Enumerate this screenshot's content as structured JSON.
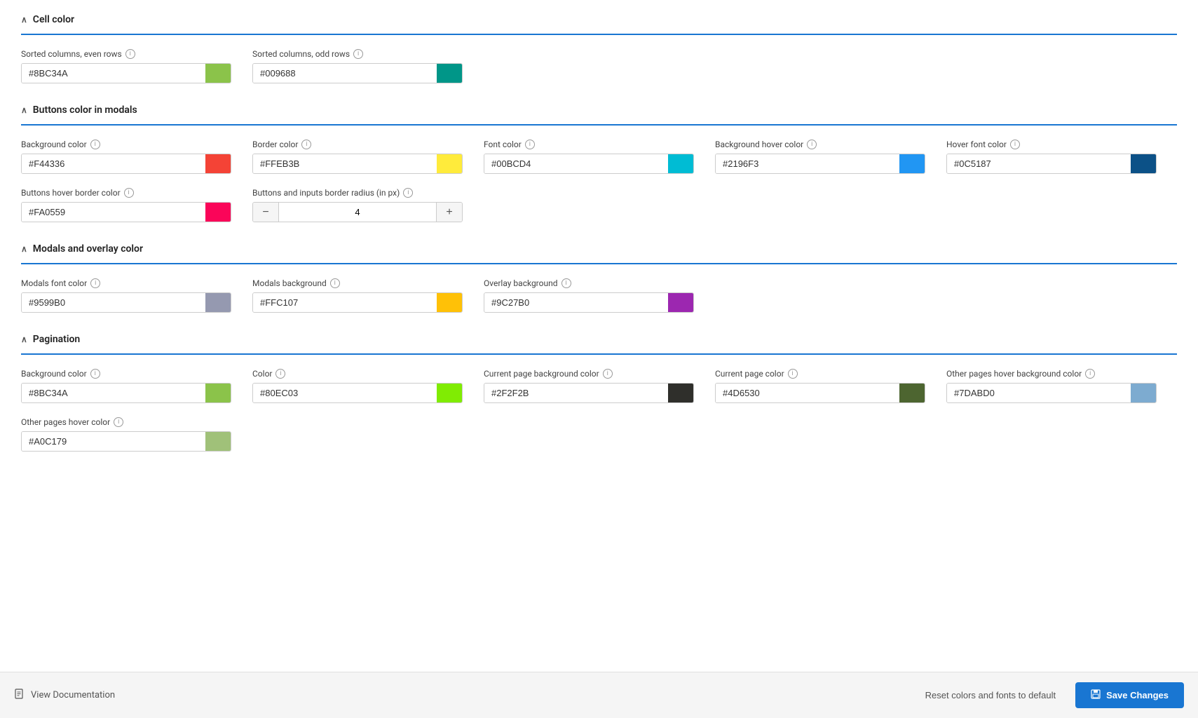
{
  "sections": [
    {
      "id": "cell-color",
      "title": "Cell color",
      "fields": [
        {
          "id": "sorted-even",
          "label": "Sorted columns, even rows",
          "value": "#8BC34A",
          "swatchColor": "#8BC34A"
        },
        {
          "id": "sorted-odd",
          "label": "Sorted columns, odd rows",
          "value": "#009688",
          "swatchColor": "#009688"
        }
      ]
    },
    {
      "id": "buttons-modal-color",
      "title": "Buttons color in modals",
      "fields": [
        {
          "id": "bg-color",
          "label": "Background color",
          "value": "#F44336",
          "swatchColor": "#F44336"
        },
        {
          "id": "border-color",
          "label": "Border color",
          "value": "#FFEB3B",
          "swatchColor": "#FFEB3B"
        },
        {
          "id": "font-color",
          "label": "Font color",
          "value": "#00BCD4",
          "swatchColor": "#00BCD4"
        },
        {
          "id": "bg-hover-color",
          "label": "Background hover color",
          "value": "#2196F3",
          "swatchColor": "#2196F3"
        },
        {
          "id": "hover-font-color",
          "label": "Hover font color",
          "value": "#0C5187",
          "swatchColor": "#0C5187"
        },
        {
          "id": "hover-border-color",
          "label": "Buttons hover border color",
          "value": "#FA0559",
          "swatchColor": "#FA0559"
        },
        {
          "id": "border-radius",
          "label": "Buttons and inputs border radius (in px)",
          "type": "stepper",
          "value": "4"
        }
      ]
    },
    {
      "id": "modals-overlay",
      "title": "Modals and overlay color",
      "fields": [
        {
          "id": "modals-font",
          "label": "Modals font color",
          "value": "#9599B0",
          "swatchColor": "#9599B0"
        },
        {
          "id": "modals-bg",
          "label": "Modals background",
          "value": "#FFC107",
          "swatchColor": "#FFC107"
        },
        {
          "id": "overlay-bg",
          "label": "Overlay background",
          "value": "#9C27B0",
          "swatchColor": "#9C27B0"
        }
      ]
    },
    {
      "id": "pagination",
      "title": "Pagination",
      "fields": [
        {
          "id": "pag-bg",
          "label": "Background color",
          "value": "#8BC34A",
          "swatchColor": "#8BC34A"
        },
        {
          "id": "pag-color",
          "label": "Color",
          "value": "#80EC03",
          "swatchColor": "#80EC03"
        },
        {
          "id": "pag-current-bg",
          "label": "Current page background color",
          "value": "#2F2F2B",
          "swatchColor": "#2F2F2B"
        },
        {
          "id": "pag-current-color",
          "label": "Current page color",
          "value": "#4D6530",
          "swatchColor": "#4D6530"
        },
        {
          "id": "pag-hover-bg",
          "label": "Other pages hover background color",
          "value": "#7DABD0",
          "swatchColor": "#7DABD0"
        },
        {
          "id": "pag-hover-color",
          "label": "Other pages hover color",
          "value": "#A0C179",
          "swatchColor": "#A0C179"
        }
      ]
    }
  ],
  "footer": {
    "view_docs_label": "View Documentation",
    "reset_label": "Reset colors and fonts to default",
    "save_label": "Save Changes",
    "doc_icon": "📄",
    "save_icon": "💾"
  }
}
